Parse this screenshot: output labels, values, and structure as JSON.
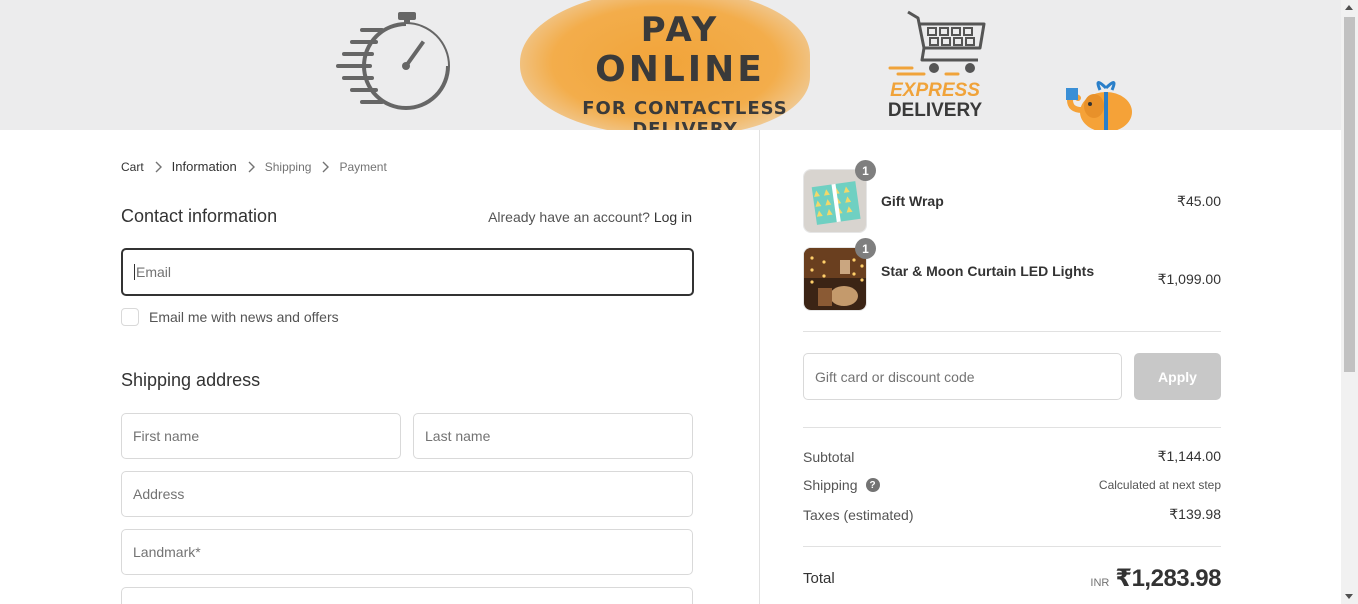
{
  "banner": {
    "line1": "PAY",
    "line2": "ONLINE",
    "line3": "FOR CONTACTLESS DELIVERY",
    "express": "EXPRESS",
    "delivery": "DELIVERY",
    "colors": {
      "accent": "#f1a43a",
      "dark": "#3a3a3a",
      "background": "#ececed"
    },
    "icons": [
      "stopwatch-icon",
      "shopping-cart-icon",
      "elephant-gift-icon"
    ]
  },
  "breadcrumb": {
    "items": [
      "Cart",
      "Information",
      "Shipping",
      "Payment"
    ],
    "current": "Information"
  },
  "contact": {
    "title": "Contact information",
    "account_prompt": "Already have an account?",
    "login_link": "Log in",
    "email_placeholder": "Email",
    "newsletter_label": "Email me with news and offers"
  },
  "shipping": {
    "title": "Shipping address",
    "first_name_placeholder": "First name",
    "last_name_placeholder": "Last name",
    "address_placeholder": "Address",
    "landmark_placeholder": "Landmark*"
  },
  "order": {
    "items": [
      {
        "name": "Gift Wrap",
        "price": "₹45.00",
        "qty": "1"
      },
      {
        "name": "Star & Moon Curtain LED Lights",
        "price": "₹1,099.00",
        "qty": "1"
      }
    ],
    "discount_placeholder": "Gift card or discount code",
    "apply_label": "Apply",
    "subtotal_label": "Subtotal",
    "subtotal": "₹1,144.00",
    "shipping_label": "Shipping",
    "shipping_value": "Calculated at next step",
    "taxes_label": "Taxes (estimated)",
    "taxes": "₹139.98",
    "total_label": "Total",
    "currency": "INR",
    "total": "₹1,283.98"
  }
}
